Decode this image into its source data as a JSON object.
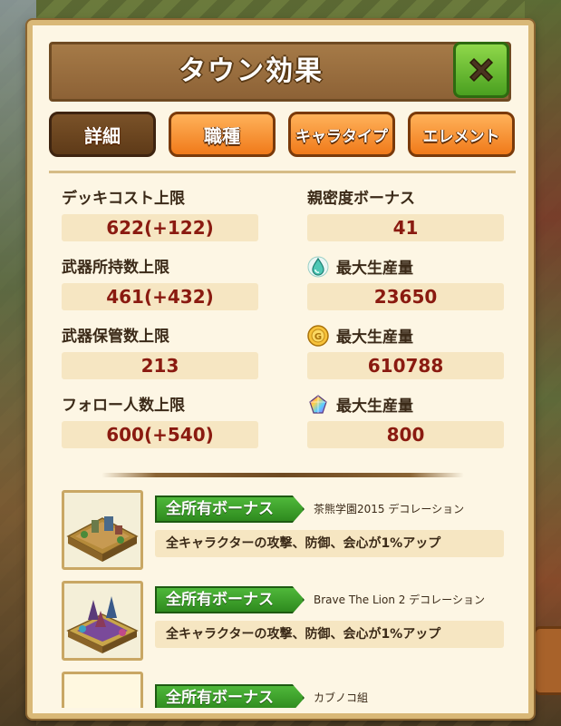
{
  "title": "タウン効果",
  "tabs": [
    {
      "label": "詳細",
      "active": true
    },
    {
      "label": "職種",
      "active": false
    },
    {
      "label": "キャラタイプ",
      "active": false
    },
    {
      "label": "エレメント",
      "active": false
    }
  ],
  "stats_left": [
    {
      "label": "デッキコスト上限",
      "value": "622(+122)"
    },
    {
      "label": "武器所持数上限",
      "value": "461(+432)"
    },
    {
      "label": "武器保管数上限",
      "value": "213"
    },
    {
      "label": "フォロー人数上限",
      "value": "600(+540)"
    }
  ],
  "stats_right": [
    {
      "label": "親密度ボーナス",
      "value": "41",
      "icon": ""
    },
    {
      "label": "最大生産量",
      "value": "23650",
      "icon": "mana-drop-icon"
    },
    {
      "label": "最大生産量",
      "value": "610788",
      "icon": "gold-coin-icon"
    },
    {
      "label": "最大生産量",
      "value": "800",
      "icon": "rainbow-crystal-icon"
    }
  ],
  "bonuses": [
    {
      "badge": "全所有ボーナス",
      "name": "茶熊学園2015 デコレーション",
      "desc": "全キャラクターの攻撃、防御、会心が1%アップ"
    },
    {
      "badge": "全所有ボーナス",
      "name": "Brave The Lion 2 デコレーション",
      "desc": "全キャラクターの攻撃、防御、会心が1%アップ"
    },
    {
      "badge": "全所有ボーナス",
      "name": "カブノコ組",
      "desc": ""
    }
  ],
  "colors": {
    "panel_bg": "#fdf6e4",
    "value_text": "#8a1a10",
    "badge_green": "#2e8a1e",
    "tab_orange": "#f07a1a",
    "tab_active": "#5e3a18"
  }
}
